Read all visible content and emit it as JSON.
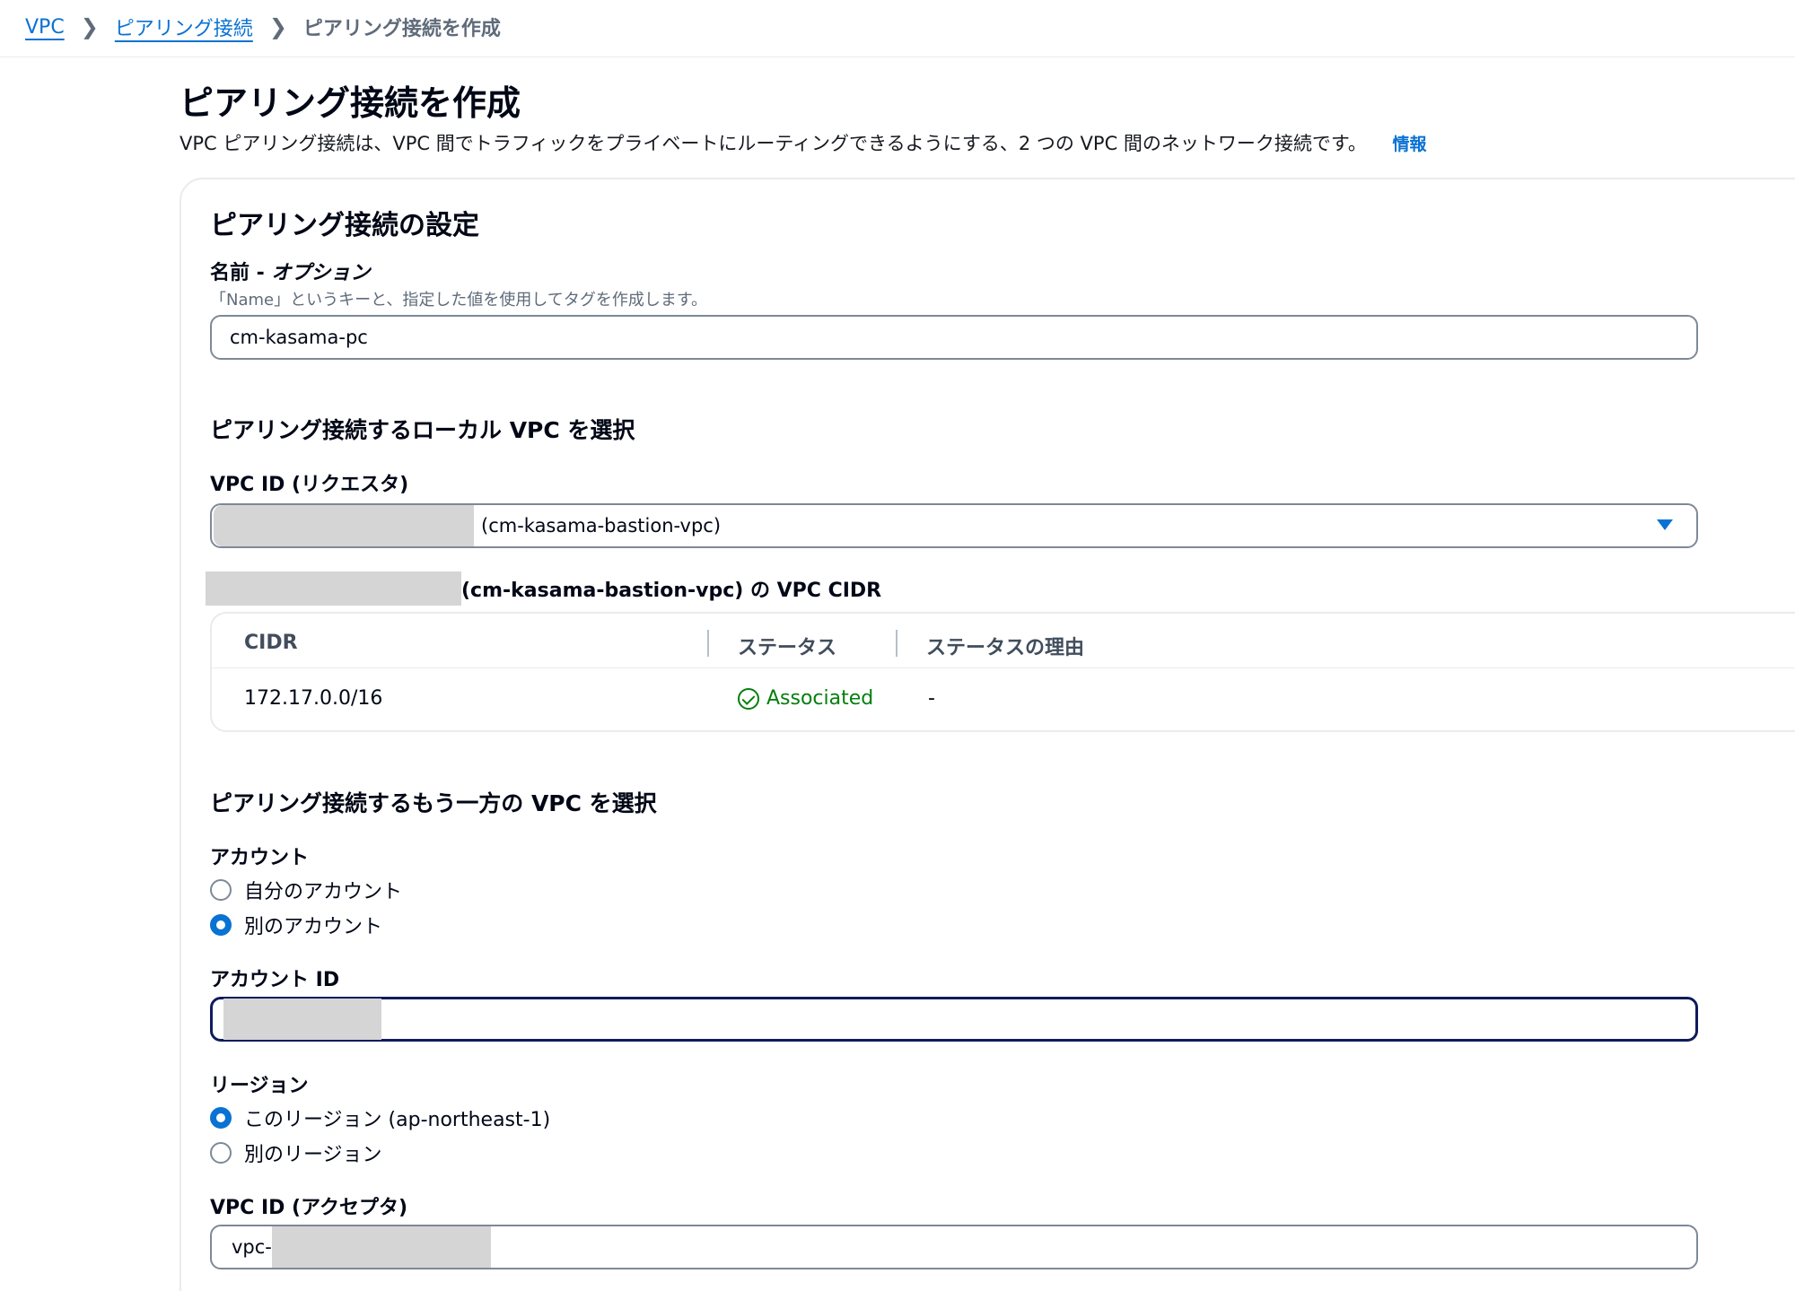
{
  "breadcrumb": {
    "items": [
      "VPC",
      "ピアリング接続"
    ],
    "current": "ピアリング接続を作成"
  },
  "header": {
    "title": "ピアリング接続を作成",
    "description": "VPC ピアリング接続は、VPC 間でトラフィックをプライベートにルーティングできるようにする、2 つの VPC 間のネットワーク接続です。",
    "info_link": "情報"
  },
  "settings": {
    "title": "ピアリング接続の設定",
    "name_label_main": "名前 - ",
    "name_label_opt": "オプション",
    "name_hint": "「Name」というキーと、指定した値を使用してタグを作成します。",
    "name_value": "cm-kasama-pc"
  },
  "local_vpc": {
    "title": "ピアリング接続するローカル VPC を選択",
    "vpc_label": "VPC ID (リクエスタ)",
    "vpc_value_suffix": "(cm-kasama-bastion-vpc)",
    "cidr_caption_suffix": "(cm-kasama-bastion-vpc) の VPC CIDR",
    "table": {
      "headers": [
        "CIDR",
        "ステータス",
        "ステータスの理由"
      ],
      "row": {
        "cidr": "172.17.0.0/16",
        "status": "Associated",
        "reason": "-"
      }
    }
  },
  "peer_vpc": {
    "title": "ピアリング接続するもう一方の VPC を選択",
    "account_label": "アカウント",
    "account_options": [
      "自分のアカウント",
      "別のアカウント"
    ],
    "account_selected": 1,
    "account_id_label": "アカウント ID",
    "region_label": "リージョン",
    "region_options": [
      "このリージョン (ap-northeast-1)",
      "別のリージョン"
    ],
    "region_selected": 0,
    "accepter_label": "VPC ID (アクセプタ)",
    "accepter_value_prefix": "vpc-"
  },
  "colors": {
    "link": "#0972d3",
    "success": "#037f0c",
    "focus_border": "#0f1b5c"
  },
  "icons": {
    "breadcrumb_separator": "chevron-right-icon",
    "status": "check-circle-icon",
    "select": "caret-down-icon"
  }
}
